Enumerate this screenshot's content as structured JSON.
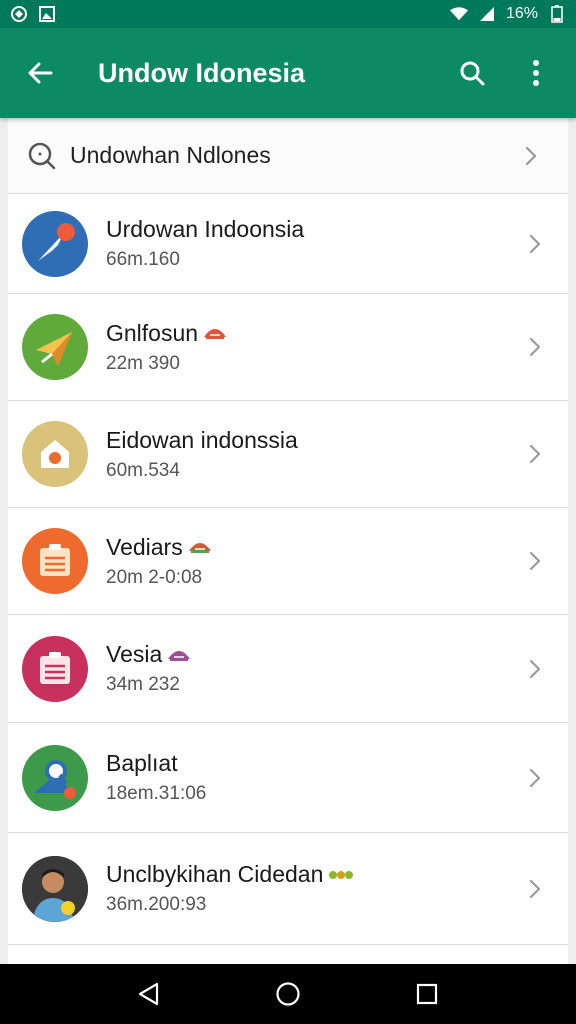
{
  "status_bar": {
    "battery_text": "16%",
    "colors": {
      "background": "#00785a"
    }
  },
  "app_bar": {
    "title": "Undow Idonesia",
    "back_icon": "arrow-left-icon",
    "search_icon": "search-icon",
    "menu_icon": "more-vert-icon",
    "colors": {
      "background": "#0b8a64"
    }
  },
  "search": {
    "value": "Undowhan Ndlones"
  },
  "items": [
    {
      "title": "Urdowan Indoonsia",
      "subtitle": "66m.160",
      "icon": "compass-icon",
      "color": "#2f6db5"
    },
    {
      "title": "Gnlfosun",
      "subtitle": "22m 390",
      "icon": "paper-plane-icon",
      "color": "#5faa3a",
      "badge": "#e0553a"
    },
    {
      "title": "Eidowan indonssia",
      "subtitle": "60m.534",
      "icon": "home-icon",
      "color": "#d9c37a"
    },
    {
      "title": "Vediars",
      "subtitle": "20m 2-0:08",
      "icon": "clipboard-icon",
      "color": "#ef6a2d",
      "badge": "#e0553a"
    },
    {
      "title": "Vesia",
      "subtitle": "34m 232",
      "icon": "clipboard-icon",
      "color": "#c8305d",
      "badge": "#9b4f9a"
    },
    {
      "title": "Baplıat",
      "subtitle": "18em.31:06",
      "icon": "location-pin-icon",
      "color": "#3d9a4a"
    },
    {
      "title": "Unclbykihan Cidedan",
      "subtitle": "36m.200:93",
      "icon": "person-avatar-icon",
      "color": "#2a2a2a",
      "badge": "#8ab82a"
    }
  ],
  "nav_bar": {
    "back_icon": "nav-back-icon",
    "home_icon": "nav-home-icon",
    "recents_icon": "nav-recents-icon"
  }
}
